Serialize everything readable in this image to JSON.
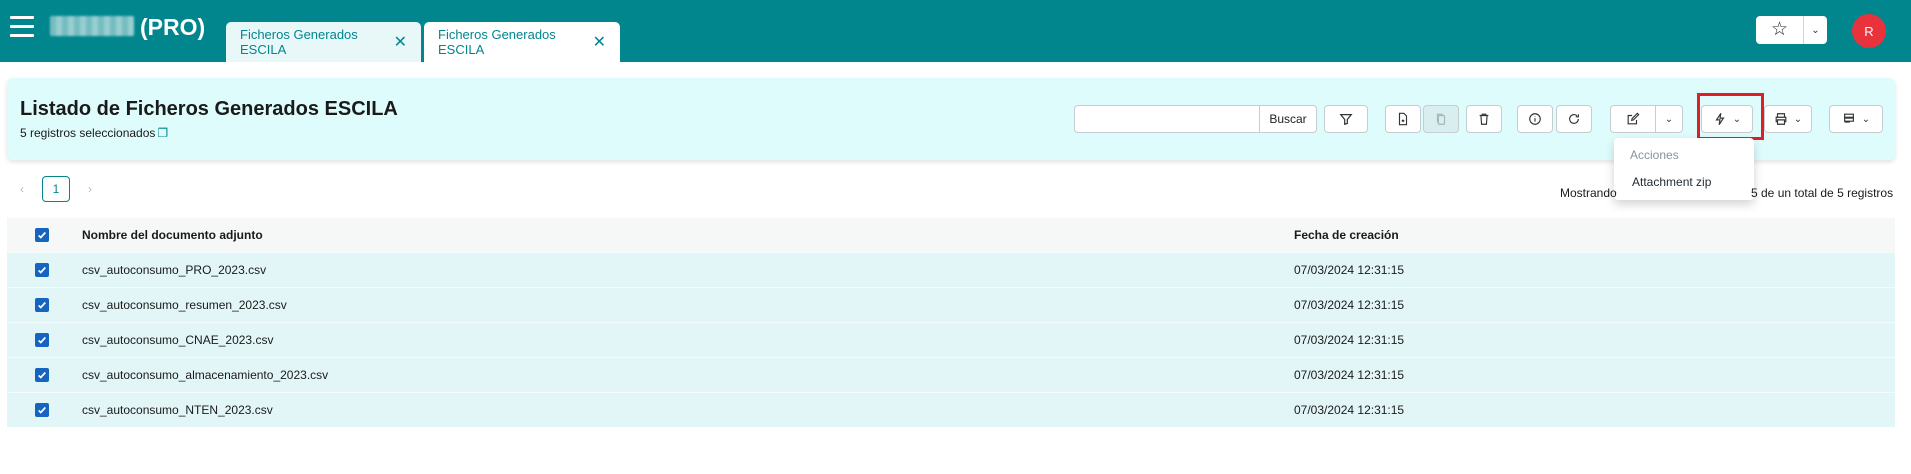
{
  "header": {
    "app_title": "(PRO)",
    "tabs": [
      {
        "label": "Ficheros Generados ESCILA",
        "active": false
      },
      {
        "label": "Ficheros Generados ESCILA",
        "active": true
      }
    ],
    "user_initial": "R",
    "icons": [
      "menu-icon",
      "star-icon",
      "chevron-down-icon",
      "close-icon"
    ]
  },
  "panel": {
    "title": "Listado de Ficheros Generados ESCILA",
    "subtitle": "5 registros seleccionados",
    "search": {
      "value": "",
      "placeholder": "",
      "button_label": "Buscar"
    }
  },
  "actions_menu": {
    "header": "Acciones",
    "items": [
      "Attachment zip"
    ]
  },
  "pagination": {
    "current_page": "1",
    "showing_left": "Mostrando",
    "showing_right": "5 de un total de 5 registros"
  },
  "table": {
    "columns": [
      "Nombre del documento adjunto",
      "Fecha de creación"
    ],
    "rows": [
      {
        "name": "csv_autoconsumo_PRO_2023.csv",
        "date": "07/03/2024 12:31:15",
        "checked": true
      },
      {
        "name": "csv_autoconsumo_resumen_2023.csv",
        "date": "07/03/2024 12:31:15",
        "checked": true
      },
      {
        "name": "csv_autoconsumo_CNAE_2023.csv",
        "date": "07/03/2024 12:31:15",
        "checked": true
      },
      {
        "name": "csv_autoconsumo_almacenamiento_2023.csv",
        "date": "07/03/2024 12:31:15",
        "checked": true
      },
      {
        "name": "csv_autoconsumo_NTEN_2023.csv",
        "date": "07/03/2024 12:31:15",
        "checked": true
      }
    ]
  },
  "colors": {
    "primary": "#01868e",
    "panel_bg": "#dffcfd",
    "row_selected": "#e2f6f8",
    "highlight": "#e01e26",
    "checkbox": "#1565c0",
    "avatar": "#e8333c"
  }
}
